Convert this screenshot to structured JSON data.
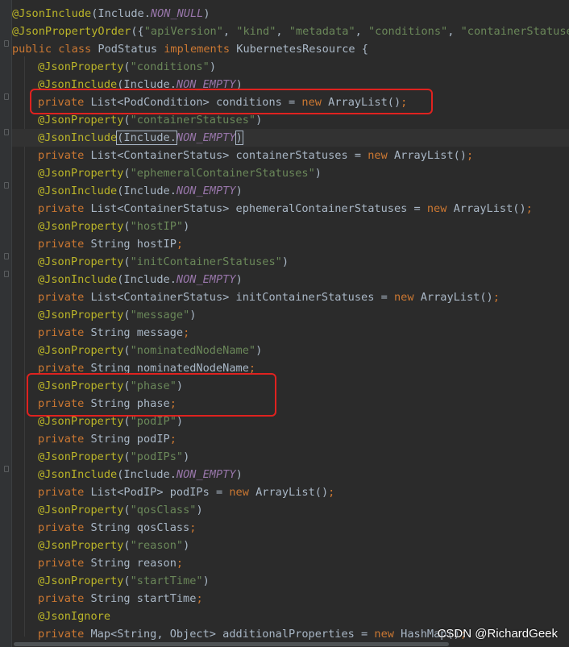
{
  "code": {
    "l0": {
      "a1": "@JsonInclude",
      "t1": "(Include.",
      "c1": "NON_NULL",
      "t2": ")"
    },
    "l1": {
      "a1": "@JsonPropertyOrder",
      "t1": "({",
      "s1": "\"apiVersion\"",
      "c1": ", ",
      "s2": "\"kind\"",
      "c2": ", ",
      "s3": "\"metadata\"",
      "c3": ", ",
      "s4": "\"conditions\"",
      "c4": ", ",
      "s5": "\"containerStatuses\""
    },
    "l2": {
      "k1": "public class ",
      "t1": "PodStatus ",
      "k2": "implements ",
      "t2": "KubernetesResource {"
    },
    "l3": {
      "a1": "@JsonProperty",
      "t1": "(",
      "s1": "\"conditions\"",
      "t2": ")"
    },
    "l4": {
      "a1": "@JsonInclude",
      "t1": "(Include.",
      "c1": "NON_EMPTY",
      "t2": ")"
    },
    "l5": {
      "k1": "private ",
      "t1": "List<PodCondition> conditions = ",
      "k2": "new ",
      "t2": "ArrayList()",
      "k3": ";"
    },
    "l6": {
      "a1": "@JsonProperty",
      "t1": "(",
      "s1": "\"containerStatuses\"",
      "t2": ")"
    },
    "l7": {
      "a1": "@JsonInclude",
      "t1": "(Include.",
      "c1": "NON_EMPTY",
      "t2": ")"
    },
    "l8": {
      "k1": "private ",
      "t1": "List<ContainerStatus> containerStatuses = ",
      "k2": "new ",
      "t2": "ArrayList()",
      "k3": ";"
    },
    "l9": {
      "a1": "@JsonProperty",
      "t1": "(",
      "s1": "\"ephemeralContainerStatuses\"",
      "t2": ")"
    },
    "l10": {
      "a1": "@JsonInclude",
      "t1": "(Include.",
      "c1": "NON_EMPTY",
      "t2": ")"
    },
    "l11": {
      "k1": "private ",
      "t1": "List<ContainerStatus> ephemeralContainerStatuses = ",
      "k2": "new ",
      "t2": "ArrayList()",
      "k3": ";"
    },
    "l12": {
      "a1": "@JsonProperty",
      "t1": "(",
      "s1": "\"hostIP\"",
      "t2": ")"
    },
    "l13": {
      "k1": "private ",
      "t1": "String hostIP",
      "k2": ";"
    },
    "l14": {
      "a1": "@JsonProperty",
      "t1": "(",
      "s1": "\"initContainerStatuses\"",
      "t2": ")"
    },
    "l15": {
      "a1": "@JsonInclude",
      "t1": "(Include.",
      "c1": "NON_EMPTY",
      "t2": ")"
    },
    "l16": {
      "k1": "private ",
      "t1": "List<ContainerStatus> initContainerStatuses = ",
      "k2": "new ",
      "t2": "ArrayList()",
      "k3": ";"
    },
    "l17": {
      "a1": "@JsonProperty",
      "t1": "(",
      "s1": "\"message\"",
      "t2": ")"
    },
    "l18": {
      "k1": "private ",
      "t1": "String message",
      "k2": ";"
    },
    "l19": {
      "a1": "@JsonProperty",
      "t1": "(",
      "s1": "\"nominatedNodeName\"",
      "t2": ")"
    },
    "l20": {
      "k1": "private ",
      "t1": "String nominatedNodeName",
      "k2": ";"
    },
    "l21": {
      "a1": "@JsonProperty",
      "t1": "(",
      "s1": "\"phase\"",
      "t2": ")"
    },
    "l22": {
      "k1": "private ",
      "t1": "String phase",
      "k2": ";"
    },
    "l23": {
      "a1": "@JsonProperty",
      "t1": "(",
      "s1": "\"podIP\"",
      "t2": ")"
    },
    "l24": {
      "k1": "private ",
      "t1": "String podIP",
      "k2": ";"
    },
    "l25": {
      "a1": "@JsonProperty",
      "t1": "(",
      "s1": "\"podIPs\"",
      "t2": ")"
    },
    "l26": {
      "a1": "@JsonInclude",
      "t1": "(Include.",
      "c1": "NON_EMPTY",
      "t2": ")"
    },
    "l27": {
      "k1": "private ",
      "t1": "List<PodIP> podIPs = ",
      "k2": "new ",
      "t2": "ArrayList()",
      "k3": ";"
    },
    "l28": {
      "a1": "@JsonProperty",
      "t1": "(",
      "s1": "\"qosClass\"",
      "t2": ")"
    },
    "l29": {
      "k1": "private ",
      "t1": "String qosClass",
      "k2": ";"
    },
    "l30": {
      "a1": "@JsonProperty",
      "t1": "(",
      "s1": "\"reason\"",
      "t2": ")"
    },
    "l31": {
      "k1": "private ",
      "t1": "String reason",
      "k2": ";"
    },
    "l32": {
      "a1": "@JsonProperty",
      "t1": "(",
      "s1": "\"startTime\"",
      "t2": ")"
    },
    "l33": {
      "k1": "private ",
      "t1": "String startTime",
      "k2": ";"
    },
    "l34": {
      "a1": "@JsonIgnore"
    },
    "l35": {
      "k1": "private ",
      "t1": "Map<String, Object> additionalProperties = ",
      "k2": "new ",
      "t2": "HashMap()",
      "k3": ";"
    }
  },
  "watermark": "CSDN @RichardGeek",
  "colors": {
    "background": "#2b2b2b",
    "annotation": "#bbb529",
    "keyword": "#cc7832",
    "string": "#6a8759",
    "constant": "#9876aa",
    "text": "#a9b7c6",
    "highlight_box": "#e0221f"
  },
  "icons": {
    "bulb": "lightbulb-icon",
    "fold": "fold-marker-icon"
  }
}
